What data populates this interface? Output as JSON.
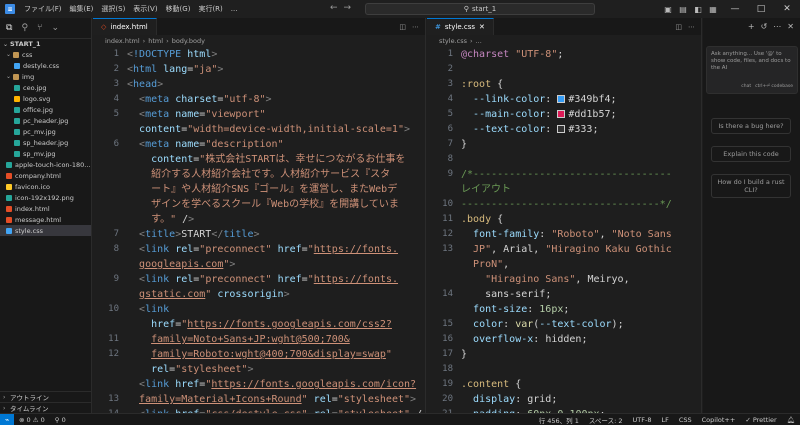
{
  "titlebar": {
    "menu": [
      "ファイル(F)",
      "編集(E)",
      "選択(S)",
      "表示(V)",
      "移動(G)",
      "実行(R)",
      "..."
    ],
    "search_text": "start_1",
    "search_icon": "search-icon"
  },
  "sidebar": {
    "root_label": "START_1",
    "items": [
      {
        "label": "css",
        "type": "folder",
        "depth": 1
      },
      {
        "label": "destyle.css",
        "type": "css",
        "depth": 2
      },
      {
        "label": "img",
        "type": "folder",
        "depth": 1
      },
      {
        "label": "ceo.jpg",
        "type": "image",
        "depth": 2
      },
      {
        "label": "logo.svg",
        "type": "svg",
        "depth": 2
      },
      {
        "label": "office.jpg",
        "type": "image",
        "depth": 2
      },
      {
        "label": "pc_header.jpg",
        "type": "image",
        "depth": 2
      },
      {
        "label": "pc_mv.jpg",
        "type": "image",
        "depth": 2
      },
      {
        "label": "sp_header.jpg",
        "type": "image",
        "depth": 2
      },
      {
        "label": "sp_mv.jpg",
        "type": "image",
        "depth": 2
      },
      {
        "label": "apple-touch-icon-180...",
        "type": "image",
        "depth": 1
      },
      {
        "label": "company.html",
        "type": "html",
        "depth": 1
      },
      {
        "label": "favicon.ico",
        "type": "ico",
        "depth": 1
      },
      {
        "label": "icon-192x192.png",
        "type": "image",
        "depth": 1
      },
      {
        "label": "index.html",
        "type": "html",
        "depth": 1
      },
      {
        "label": "message.html",
        "type": "html",
        "depth": 1
      },
      {
        "label": "style.css",
        "type": "css",
        "depth": 1,
        "selected": true
      }
    ],
    "outline_label": "アウトライン",
    "timeline_label": "タイムライン"
  },
  "editor_left": {
    "tab_label": "index.html",
    "breadcrumb": [
      "index.html",
      "html",
      "body.body"
    ],
    "line_numbers": [
      "1",
      "2",
      "3",
      "4",
      "5",
      "",
      "6",
      "",
      "",
      "",
      "",
      "",
      "7",
      "8",
      "",
      "9",
      "",
      "10",
      "",
      "11",
      "12",
      "",
      "",
      "13",
      "14",
      "",
      "15",
      ""
    ]
  },
  "editor_right": {
    "tab_label": "style.css",
    "breadcrumb": [
      "style.css",
      "..."
    ],
    "line_numbers": [
      "1",
      "2",
      "3",
      "4",
      "5",
      "6",
      "7",
      "8",
      "9",
      "",
      "10",
      "11",
      "12",
      "13",
      "",
      "",
      "14",
      "",
      "15",
      "16",
      "17",
      "18",
      "19",
      "20",
      "21",
      "22",
      "23",
      ""
    ]
  },
  "chat": {
    "placeholder": "Ask anything... Use '@' to show code, files, and docs to the AI",
    "footer_chat": "chat",
    "footer_codebase": "ctrl+⏎ codebase",
    "suggestions": [
      "Is there a bug here?",
      "Explain this code",
      "How do I build a rust CLI?"
    ]
  },
  "statusbar": {
    "problems": "⊗ 0 ⚠ 0",
    "ports": "⚲ 0",
    "cursor": "行 456、列 1",
    "spaces": "スペース: 2",
    "encoding": "UTF-8",
    "eol": "LF",
    "language": "CSS",
    "copilot": "Copilot++",
    "prettier": "✓ Prettier"
  },
  "colors": {
    "link": "#349bf4",
    "main": "#dd1b57",
    "text": "#333333"
  }
}
